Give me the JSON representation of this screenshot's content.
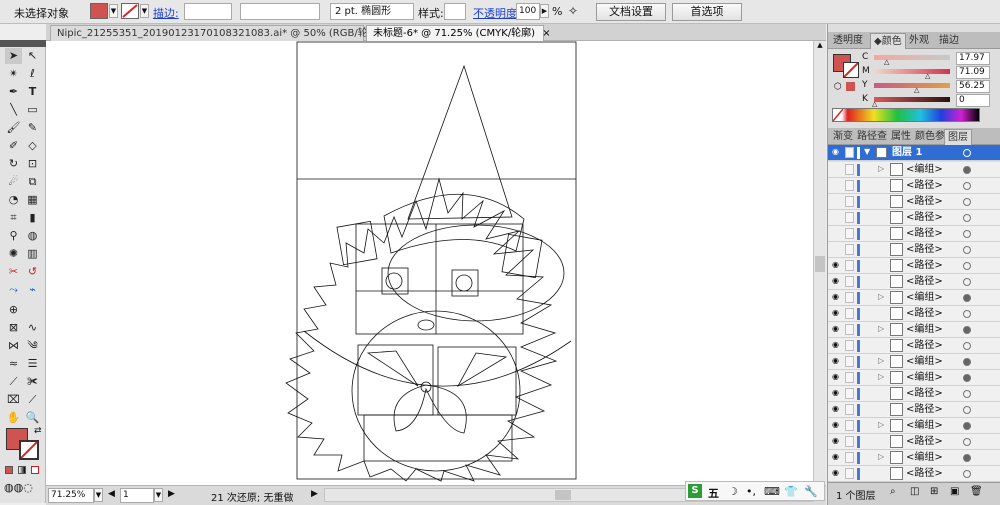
{
  "control_bar": {
    "selection_label": "未选择对象",
    "stroke_label": "描边:",
    "brush_label": "2 pt. 椭圆形",
    "style_label": "样式:",
    "opacity_label": "不透明度:",
    "opacity_value": "100",
    "percent": "%",
    "doc_setup": "文档设置",
    "preferences": "首选项"
  },
  "tabs": [
    {
      "label": "Nipic_21255351_20190123170108321083.ai* @ 50% (RGB/轮廓)"
    },
    {
      "label": "未标题-6* @ 71.25% (CMYK/轮廓)"
    }
  ],
  "close_glyph": "×",
  "status": {
    "zoom": "71.25%",
    "page": "1",
    "undo": "21 次还原; 无重做"
  },
  "color_panel": {
    "tabs": [
      "透明度",
      "颜色",
      "外观",
      "描边"
    ],
    "channels": [
      {
        "label": "C",
        "value": "17.97"
      },
      {
        "label": "M",
        "value": "71.09"
      },
      {
        "label": "Y",
        "value": "56.25"
      },
      {
        "label": "K",
        "value": "0"
      }
    ],
    "fill_color": "#cf5451"
  },
  "layers_panel": {
    "tabs": [
      "渐变",
      "路径查",
      "属性",
      "颜色参",
      "图层"
    ],
    "layer_name": "图层 1",
    "footer": "1 个图层",
    "rows": [
      {
        "label": "<编组>",
        "eye": false,
        "expand": true
      },
      {
        "label": "<路径>",
        "eye": false,
        "expand": false
      },
      {
        "label": "<路径>",
        "eye": false,
        "expand": false
      },
      {
        "label": "<路径>",
        "eye": false,
        "expand": false
      },
      {
        "label": "<路径>",
        "eye": false,
        "expand": false
      },
      {
        "label": "<路径>",
        "eye": false,
        "expand": false
      },
      {
        "label": "<路径>",
        "eye": true,
        "expand": false
      },
      {
        "label": "<路径>",
        "eye": true,
        "expand": false
      },
      {
        "label": "<编组>",
        "eye": true,
        "expand": true
      },
      {
        "label": "<路径>",
        "eye": true,
        "expand": false
      },
      {
        "label": "<编组>",
        "eye": true,
        "expand": true
      },
      {
        "label": "<路径>",
        "eye": true,
        "expand": false
      },
      {
        "label": "<编组>",
        "eye": true,
        "expand": true
      },
      {
        "label": "<编组>",
        "eye": true,
        "expand": true
      },
      {
        "label": "<路径>",
        "eye": true,
        "expand": false
      },
      {
        "label": "<路径>",
        "eye": true,
        "expand": false
      },
      {
        "label": "<编组>",
        "eye": true,
        "expand": true
      },
      {
        "label": "<路径>",
        "eye": true,
        "expand": false
      },
      {
        "label": "<编组>",
        "eye": true,
        "expand": true
      },
      {
        "label": "<路径>",
        "eye": true,
        "expand": false
      }
    ]
  },
  "ime": {
    "badge": "S",
    "label": "五"
  }
}
